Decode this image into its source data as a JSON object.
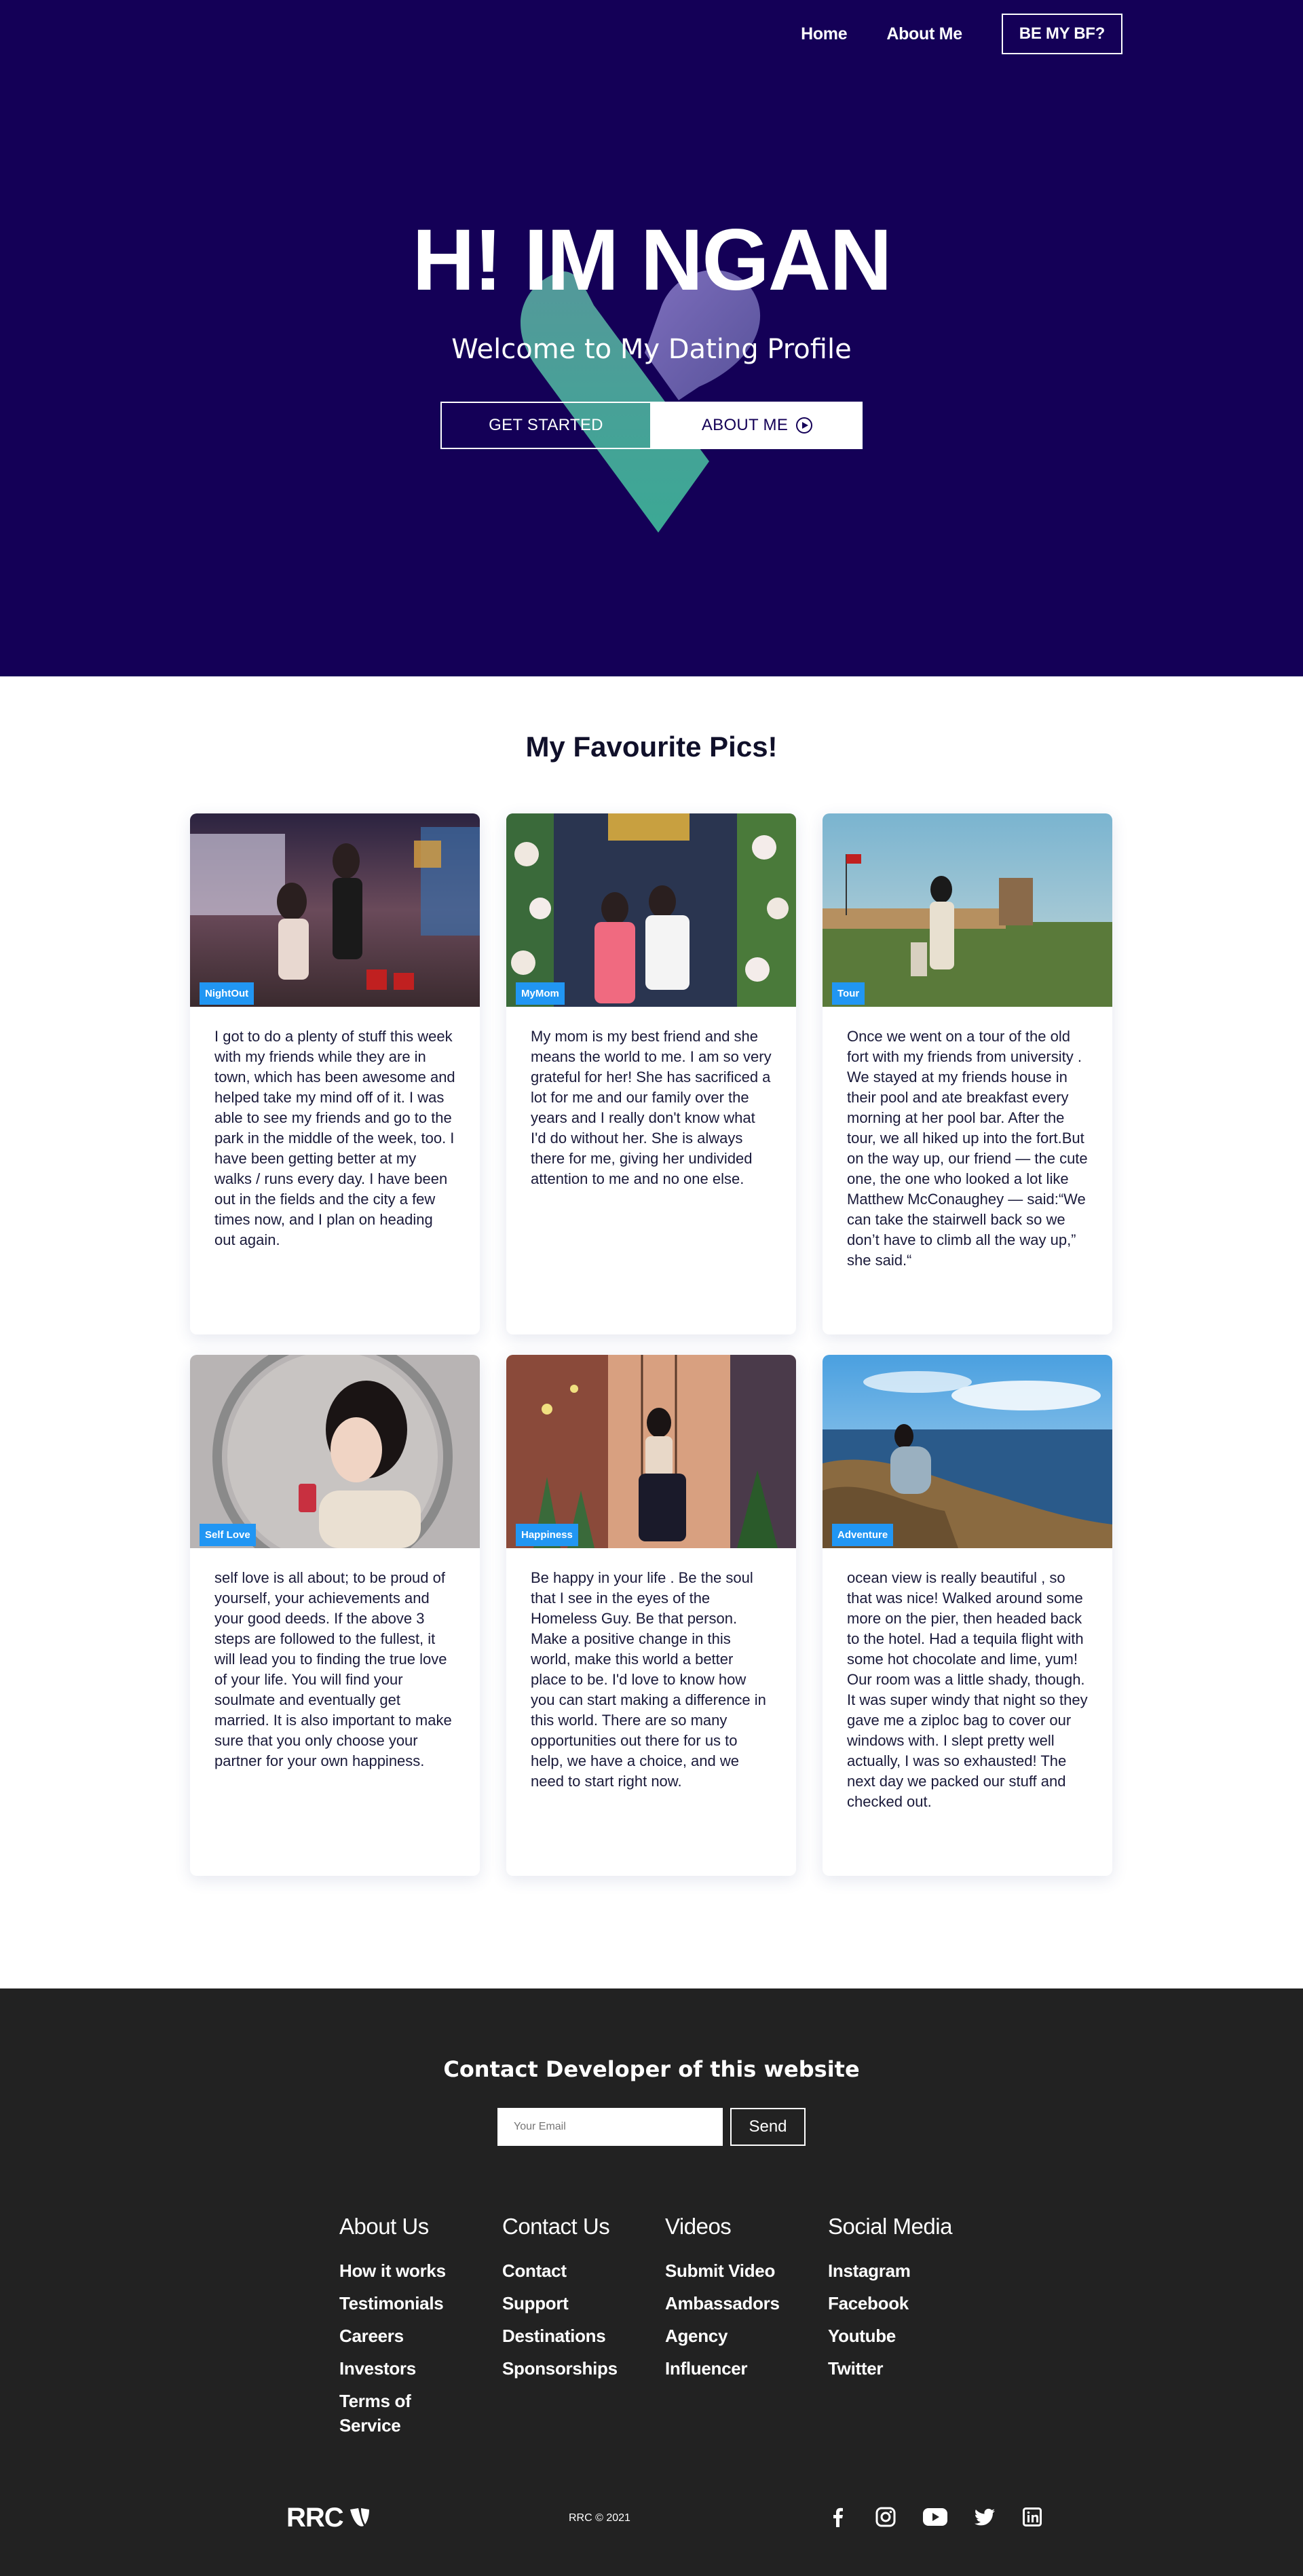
{
  "nav": {
    "home": "Home",
    "about": "About Me",
    "cta": "BE MY BF?"
  },
  "hero": {
    "title": "H! IM NGAN",
    "subtitle": "Welcome to My Dating Profile",
    "btn_start": "GET STARTED",
    "btn_about": "ABOUT ME",
    "bg_color": "#140057"
  },
  "gallery": {
    "title": "My Favourite Pics!",
    "cards": [
      {
        "tag": "NightOut",
        "text": "I got to do a plenty of stuff this week with my friends while they are in town, which has been awesome and helped take my mind off of it. I was able to see my friends and go to the park in the middle of the week, too. I have been getting better at my walks / runs every day. I have been out in the fields and the city a few times now, and I plan on heading out again."
      },
      {
        "tag": "MyMom",
        "text": "My mom is my best friend and she means the world to me. I am so very grateful for her! She has sacrificed a lot for me and our family over the years and I really don't know what I'd do without her. She is always there for me, giving her undivided attention to me and no one else."
      },
      {
        "tag": "Tour",
        "text": "Once we went on a tour of the old fort with my friends from university . We stayed at my friends house in their pool and ate breakfast every morning at her pool bar. After the tour, we all hiked up into the fort.But on the way up, our friend — the cute one, the one who looked a lot like Matthew McConaughey — said:“We can take the stairwell back so we don’t have to climb all the way up,” she said.“"
      },
      {
        "tag": "Self Love",
        "text": "self love is all about; to be proud of yourself, your achievements and your good deeds. If the above 3 steps are followed to the fullest, it will lead you to finding the true love of your life. You will find your soulmate and eventually get married. It is also important to make sure that you only choose your partner for your own happiness."
      },
      {
        "tag": "Happiness",
        "text": "Be happy in your life . Be the soul that I see in the eyes of the Homeless Guy. Be that person. Make a positive change in this world, make this world a better place to be. I'd love to know how you can start making a difference in this world. There are so many opportunities out there for us to help, we have a choice, and we need to start right now."
      },
      {
        "tag": "Adventure",
        "text": "ocean view is really beautiful , so that was nice! Walked around some more on the pier, then headed back to the hotel. Had a tequila flight with some hot chocolate and lime, yum! Our room was a little shady, though. It was super windy that night so they gave me a ziploc bag to cover our windows with. I slept pretty well actually, I was so exhausted! The next day we packed our stuff and checked out."
      }
    ]
  },
  "footer": {
    "contact_title": "Contact Developer of this website",
    "email_placeholder": "Your Email",
    "send": "Send",
    "columns": [
      {
        "title": "About Us",
        "links": [
          "How it works",
          "Testimonials",
          "Careers",
          "Investors",
          "Terms of Service"
        ]
      },
      {
        "title": "Contact Us",
        "links": [
          "Contact",
          "Support",
          "Destinations",
          "Sponsorships"
        ]
      },
      {
        "title": "Videos",
        "links": [
          "Submit Video",
          "Ambassadors",
          "Agency",
          "Influencer"
        ]
      },
      {
        "title": "Social Media",
        "links": [
          "Instagram",
          "Facebook",
          "Youtube",
          "Twitter"
        ]
      }
    ],
    "logo": "RRC",
    "copyright": "RRC © 2021",
    "social_icons": [
      "facebook-icon",
      "instagram-icon",
      "youtube-icon",
      "twitter-icon",
      "linkedin-icon"
    ]
  }
}
